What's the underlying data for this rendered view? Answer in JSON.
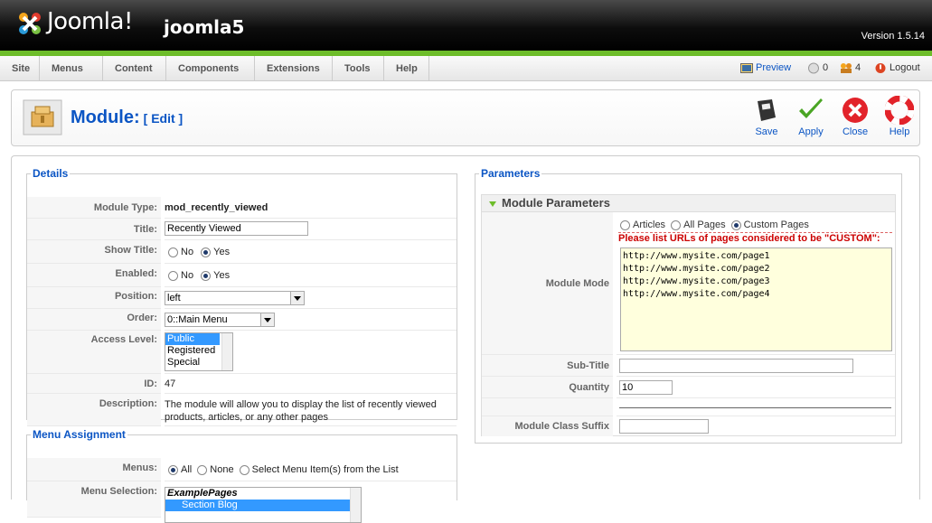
{
  "header": {
    "logo_text": "Joomla!",
    "site_name": "joomla5",
    "version": "Version 1.5.14"
  },
  "menu": [
    "Site",
    "Menus",
    "Content",
    "Components",
    "Extensions",
    "Tools",
    "Help"
  ],
  "status": {
    "preview": "Preview",
    "messages": "0",
    "users": "4",
    "logout": "Logout"
  },
  "toolbar": {
    "title": "Module:",
    "subtitle": "[ Edit ]",
    "save": "Save",
    "apply": "Apply",
    "close": "Close",
    "help": "Help"
  },
  "details": {
    "legend": "Details",
    "module_type_label": "Module Type:",
    "module_type": "mod_recently_viewed",
    "title_label": "Title:",
    "title_value": "Recently Viewed",
    "show_title_label": "Show Title:",
    "no": "No",
    "yes": "Yes",
    "enabled_label": "Enabled:",
    "position_label": "Position:",
    "position_value": "left",
    "order_label": "Order:",
    "order_value": "0::Main Menu",
    "access_label": "Access Level:",
    "access_options": [
      "Public",
      "Registered",
      "Special"
    ],
    "id_label": "ID:",
    "id_value": "47",
    "description_label": "Description:",
    "description_line1": "The module will allow you to display the list of recently viewed",
    "description_line2": "products, articles, or any other pages"
  },
  "menu_assignment": {
    "legend": "Menu Assignment",
    "menus_label": "Menus:",
    "all": "All",
    "none": "None",
    "select": "Select Menu Item(s) from the List",
    "selection_label": "Menu Selection:",
    "selection_group": "ExamplePages",
    "selection_item": "Section Blog"
  },
  "parameters": {
    "legend": "Parameters",
    "pane_title": "Module Parameters",
    "mode_label": "Module Mode",
    "articles": "Articles",
    "all_pages": "All Pages",
    "custom_pages": "Custom Pages",
    "custom_note": "Please list URLs of pages considered to be \"CUSTOM\":",
    "urls": [
      "http://www.mysite.com/page1",
      "http://www.mysite.com/page2",
      "http://www.mysite.com/page3",
      "http://www.mysite.com/page4"
    ],
    "subtitle_label": "Sub-Title",
    "subtitle_value": "",
    "quantity_label": "Quantity",
    "quantity_value": "10",
    "suffix_label": "Module Class Suffix",
    "suffix_value": ""
  },
  "colors": {
    "accent_blue": "#0b55c4",
    "brand_green": "#6dbd2a",
    "warning_red": "#cc0000"
  }
}
